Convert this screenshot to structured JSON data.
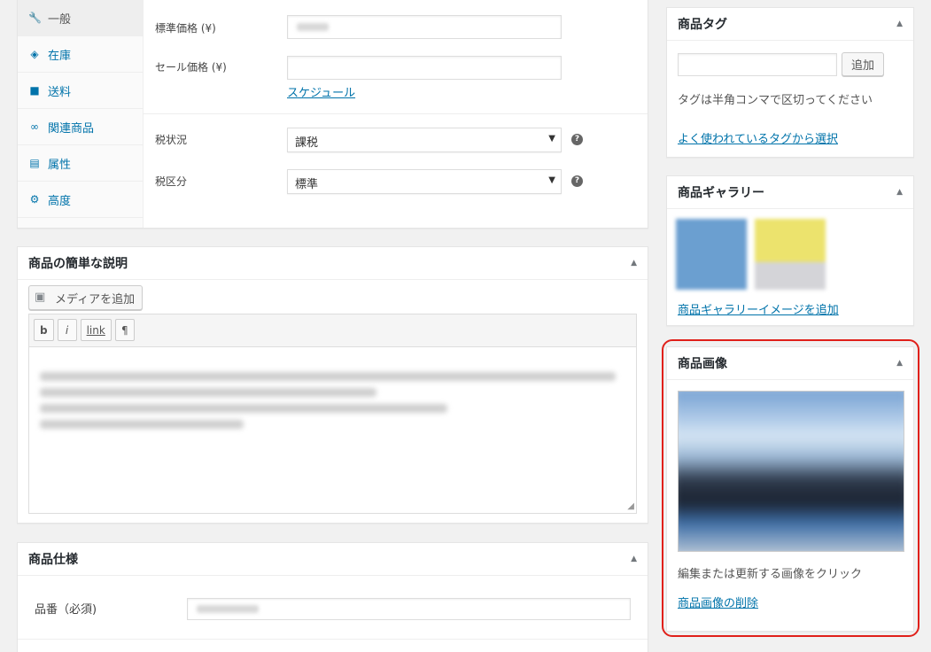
{
  "product_data": {
    "tabs": [
      {
        "label": "一般",
        "icon": "wrench-icon",
        "glyph": "🔧"
      },
      {
        "label": "在庫",
        "icon": "tag-icon",
        "glyph": "◈"
      },
      {
        "label": "送料",
        "icon": "truck-icon",
        "glyph": "■"
      },
      {
        "label": "関連商品",
        "icon": "link-icon",
        "glyph": "∞"
      },
      {
        "label": "属性",
        "icon": "table-icon",
        "glyph": "▤"
      },
      {
        "label": "高度",
        "icon": "gear-icon",
        "glyph": "⚙"
      }
    ],
    "regular_price_label": "標準価格 (¥)",
    "sale_price_label": "セール価格 (¥)",
    "schedule_link": "スケジュール",
    "tax_status_label": "税状況",
    "tax_status_value": "課税",
    "tax_class_label": "税区分",
    "tax_class_value": "標準",
    "help_glyph": "?",
    "select_arrow": "▼"
  },
  "short_description": {
    "title": "商品の簡単な説明",
    "add_media": "メディアを追加",
    "quicktags": [
      "b",
      "i",
      "link",
      "¶"
    ]
  },
  "spec": {
    "title": "商品仕様",
    "sku_label": "品番（必須)"
  },
  "tags_box": {
    "title": "商品タグ",
    "add_button": "追加",
    "hint": "タグは半角コンマで区切ってください",
    "popular_link": "よく使われているタグから選択"
  },
  "gallery_box": {
    "title": "商品ギャラリー",
    "add_link": "商品ギャラリーイメージを追加",
    "thumb_colors": [
      "#6b9fd0",
      "#ece36d"
    ]
  },
  "image_box": {
    "title": "商品画像",
    "hint": "編集または更新する画像をクリック",
    "remove_link": "商品画像の削除"
  },
  "toggle_glyph": "▲",
  "highlight_color": "#e0201a"
}
